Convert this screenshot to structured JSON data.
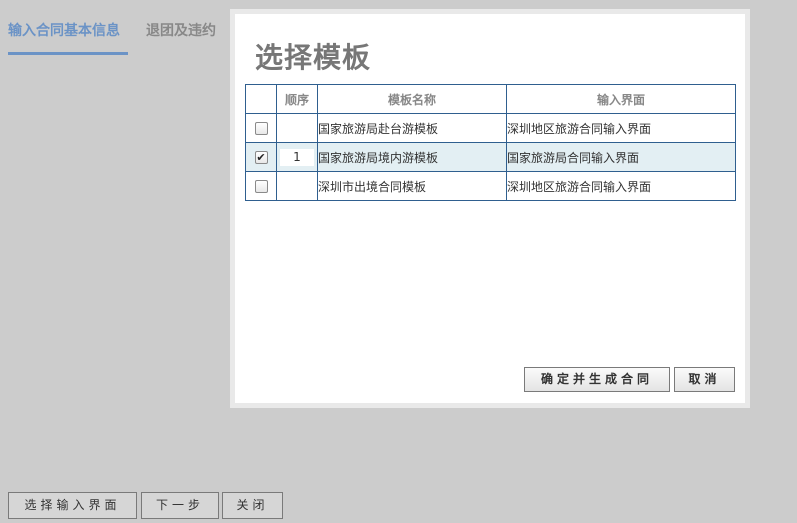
{
  "tabs": [
    {
      "label": "输入合同基本信息",
      "active": true
    },
    {
      "label": "退团及违约",
      "active": false
    }
  ],
  "modal": {
    "title": "选择模板",
    "table": {
      "headers": [
        "",
        "顺序",
        "模板名称",
        "输入界面"
      ],
      "rows": [
        {
          "checked": false,
          "order": "",
          "name": "国家旅游局赴台游模板",
          "input_ui": "深圳地区旅游合同输入界面"
        },
        {
          "checked": true,
          "order": "1",
          "name": "国家旅游局境内游模板",
          "input_ui": "国家旅游局合同输入界面"
        },
        {
          "checked": false,
          "order": "",
          "name": "深圳市出境合同模板",
          "input_ui": "深圳地区旅游合同输入界面"
        }
      ]
    },
    "confirm_label": "确定并生成合同",
    "cancel_label": "取消"
  },
  "footer": {
    "select_ui_label": "选择输入界面",
    "next_label": "下一步",
    "close_label": "关闭"
  },
  "colors": {
    "accent": "#6b93c6",
    "selected_row": "#e3eff3",
    "table_border": "#2f5f8f"
  }
}
